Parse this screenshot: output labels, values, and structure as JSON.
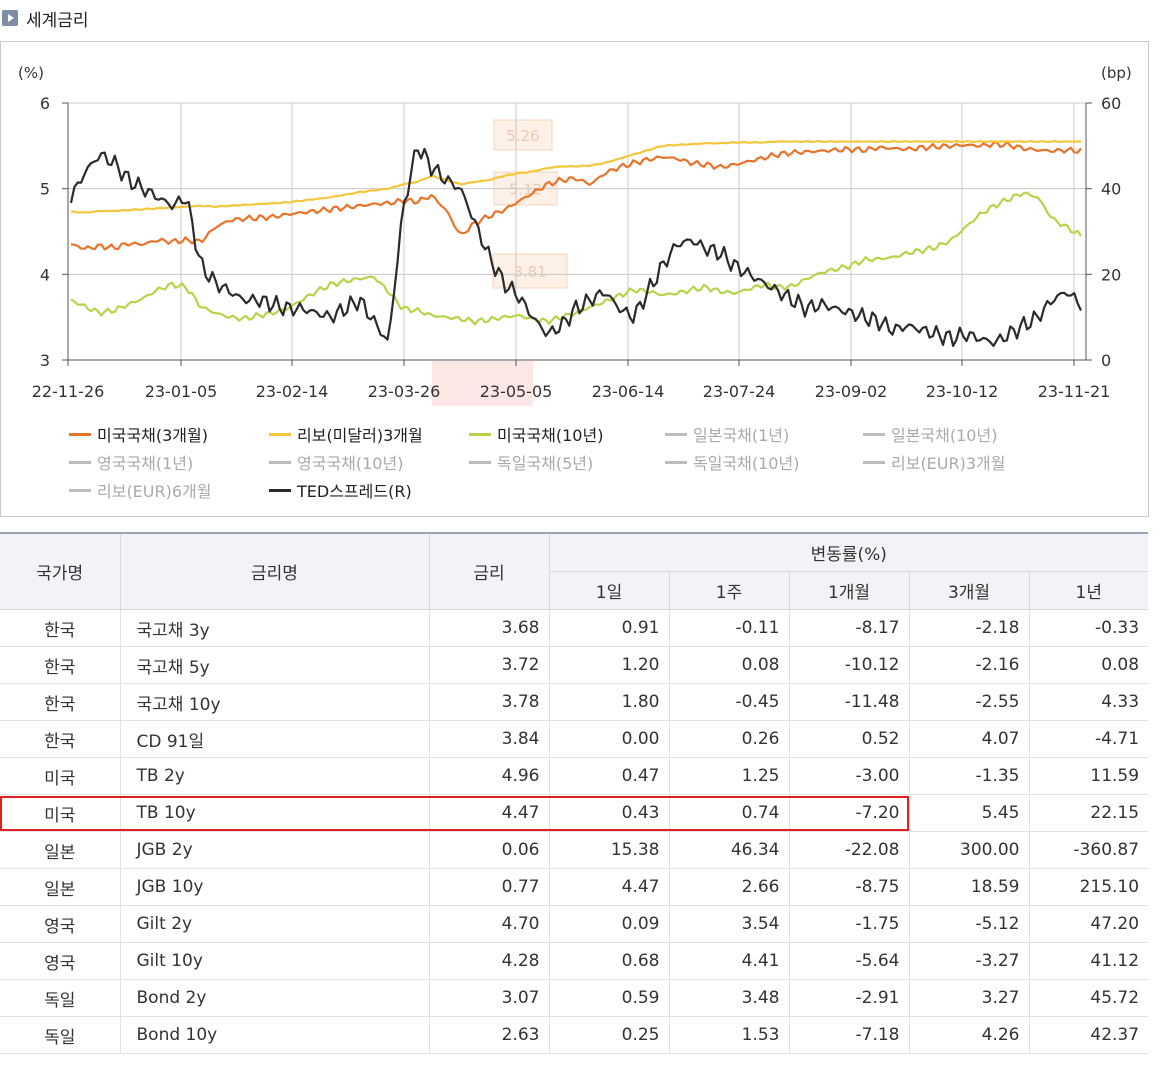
{
  "section": {
    "title": "세계금리",
    "icon": "play-icon"
  },
  "chart_data": {
    "type": "line",
    "left_axis": {
      "unit_label": "(%)",
      "ticks": [
        "6",
        "5",
        "4",
        "3"
      ],
      "range": [
        3,
        6
      ]
    },
    "right_axis": {
      "unit_label": "(bp)",
      "ticks": [
        "60",
        "40",
        "20",
        "0"
      ],
      "range": [
        0,
        60
      ]
    },
    "x_ticks": [
      "22-11-26",
      "23-01-05",
      "23-02-14",
      "23-03-26",
      "23-05-05",
      "23-06-14",
      "23-07-24",
      "23-09-02",
      "23-10-12",
      "23-11-21"
    ],
    "grid": true,
    "tooltip_labels": [
      "5.26",
      "5.12",
      "3.81"
    ],
    "series": [
      {
        "name": "미국국채(3개월)",
        "color": "#e8732a",
        "axis": "left",
        "active": true,
        "values": [
          4.35,
          4.3,
          4.33,
          4.31,
          4.36,
          4.35,
          4.4,
          4.38,
          4.4,
          4.38,
          4.55,
          4.63,
          4.65,
          4.66,
          4.67,
          4.7,
          4.72,
          4.74,
          4.76,
          4.78,
          4.8,
          4.82,
          4.83,
          4.86,
          4.85,
          4.92,
          4.75,
          4.45,
          4.6,
          4.68,
          4.75,
          4.85,
          4.95,
          5.05,
          5.1,
          5.12,
          5.05,
          5.18,
          5.25,
          5.3,
          5.34,
          5.37,
          5.35,
          5.3,
          5.28,
          5.25,
          5.28,
          5.32,
          5.36,
          5.4,
          5.42,
          5.43,
          5.44,
          5.45,
          5.46,
          5.45,
          5.48,
          5.47,
          5.46,
          5.48,
          5.49,
          5.5,
          5.51,
          5.5,
          5.52,
          5.51,
          5.47,
          5.45,
          5.44,
          5.45,
          5.44
        ]
      },
      {
        "name": "리보(미달러)3개월",
        "color": "#f5c63b",
        "axis": "left",
        "active": true,
        "values": [
          4.73,
          4.72,
          4.74,
          4.74,
          4.75,
          4.76,
          4.77,
          4.78,
          4.79,
          4.8,
          4.79,
          4.8,
          4.81,
          4.82,
          4.83,
          4.84,
          4.86,
          4.88,
          4.9,
          4.93,
          4.96,
          4.98,
          5.0,
          5.05,
          5.08,
          5.15,
          5.1,
          5.05,
          5.08,
          5.1,
          5.15,
          5.18,
          5.2,
          5.24,
          5.26,
          5.26,
          5.27,
          5.3,
          5.35,
          5.4,
          5.45,
          5.5,
          5.51,
          5.52,
          5.53,
          5.53,
          5.54,
          5.54,
          5.54,
          5.55,
          5.55,
          5.55,
          5.55,
          5.55,
          5.55,
          5.55,
          5.55,
          5.55,
          5.55,
          5.55,
          5.55,
          5.55,
          5.55,
          5.55,
          5.55,
          5.55,
          5.55,
          5.55,
          5.55,
          5.55,
          5.55
        ]
      },
      {
        "name": "미국국채(10년)",
        "color": "#b5d44a",
        "axis": "left",
        "active": true,
        "values": [
          3.7,
          3.62,
          3.55,
          3.58,
          3.65,
          3.72,
          3.82,
          3.88,
          3.85,
          3.62,
          3.55,
          3.5,
          3.48,
          3.52,
          3.55,
          3.6,
          3.7,
          3.8,
          3.88,
          3.92,
          3.95,
          3.97,
          3.8,
          3.6,
          3.58,
          3.52,
          3.5,
          3.48,
          3.45,
          3.47,
          3.5,
          3.52,
          3.48,
          3.45,
          3.5,
          3.55,
          3.62,
          3.68,
          3.75,
          3.82,
          3.8,
          3.76,
          3.78,
          3.82,
          3.85,
          3.8,
          3.78,
          3.83,
          3.88,
          3.85,
          3.86,
          3.95,
          4.02,
          4.06,
          4.1,
          4.17,
          4.18,
          4.2,
          4.25,
          4.28,
          4.32,
          4.4,
          4.55,
          4.7,
          4.8,
          4.88,
          4.95,
          4.9,
          4.65,
          4.55,
          4.45
        ]
      },
      {
        "name": "일본국채(1년)",
        "color": "#b0b0b0",
        "axis": "left",
        "active": false
      },
      {
        "name": "일본국채(10년)",
        "color": "#b0b0b0",
        "axis": "left",
        "active": false
      },
      {
        "name": "영국국채(1년)",
        "color": "#b0b0b0",
        "axis": "left",
        "active": false
      },
      {
        "name": "영국국채(10년)",
        "color": "#b0b0b0",
        "axis": "left",
        "active": false
      },
      {
        "name": "독일국채(5년)",
        "color": "#b0b0b0",
        "axis": "left",
        "active": false
      },
      {
        "name": "독일국채(10년)",
        "color": "#b0b0b0",
        "axis": "left",
        "active": false
      },
      {
        "name": "리보(EUR)3개월",
        "color": "#b0b0b0",
        "axis": "left",
        "active": false
      },
      {
        "name": "리보(EUR)6개월",
        "color": "#b0b0b0",
        "axis": "left",
        "active": false
      },
      {
        "name": "TED스프레드(R)",
        "color": "#2b2b2b",
        "axis": "right",
        "active": true,
        "values": [
          38,
          44,
          48,
          46,
          42,
          40,
          38,
          36,
          38,
          22,
          18,
          16,
          14,
          14,
          13,
          12,
          12,
          11,
          10,
          12,
          14,
          9,
          4,
          35,
          50,
          45,
          42,
          40,
          32,
          24,
          18,
          15,
          10,
          6,
          8,
          12,
          14,
          16,
          12,
          10,
          16,
          22,
          27,
          28,
          26,
          25,
          22,
          20,
          18,
          16,
          14,
          12,
          13,
          12,
          11,
          10,
          9,
          7,
          8,
          7,
          6,
          5,
          6,
          5,
          4,
          6,
          8,
          10,
          14,
          16,
          13
        ]
      }
    ]
  },
  "table": {
    "headers": {
      "country": "국가명",
      "rate_name": "금리명",
      "rate": "금리",
      "change_group": "변동률(%)",
      "d1": "1일",
      "w1": "1주",
      "m1": "1개월",
      "m3": "3개월",
      "y1": "1년"
    },
    "rows": [
      {
        "country": "한국",
        "name": "국고채 3y",
        "rate": "3.68",
        "d1": "0.91",
        "w1": "-0.11",
        "m1": "-8.17",
        "m3": "-2.18",
        "y1": "-0.33"
      },
      {
        "country": "한국",
        "name": "국고채 5y",
        "rate": "3.72",
        "d1": "1.20",
        "w1": "0.08",
        "m1": "-10.12",
        "m3": "-2.16",
        "y1": "0.08"
      },
      {
        "country": "한국",
        "name": "국고채 10y",
        "rate": "3.78",
        "d1": "1.80",
        "w1": "-0.45",
        "m1": "-11.48",
        "m3": "-2.55",
        "y1": "4.33"
      },
      {
        "country": "한국",
        "name": "CD 91일",
        "rate": "3.84",
        "d1": "0.00",
        "w1": "0.26",
        "m1": "0.52",
        "m3": "4.07",
        "y1": "-4.71"
      },
      {
        "country": "미국",
        "name": "TB 2y",
        "rate": "4.96",
        "d1": "0.47",
        "w1": "1.25",
        "m1": "-3.00",
        "m3": "-1.35",
        "y1": "11.59"
      },
      {
        "country": "미국",
        "name": "TB 10y",
        "rate": "4.47",
        "d1": "0.43",
        "w1": "0.74",
        "m1": "-7.20",
        "m3": "5.45",
        "y1": "22.15"
      },
      {
        "country": "일본",
        "name": "JGB 2y",
        "rate": "0.06",
        "d1": "15.38",
        "w1": "46.34",
        "m1": "-22.08",
        "m3": "300.00",
        "y1": "-360.87"
      },
      {
        "country": "일본",
        "name": "JGB 10y",
        "rate": "0.77",
        "d1": "4.47",
        "w1": "2.66",
        "m1": "-8.75",
        "m3": "18.59",
        "y1": "215.10"
      },
      {
        "country": "영국",
        "name": "Gilt 2y",
        "rate": "4.70",
        "d1": "0.09",
        "w1": "3.54",
        "m1": "-1.75",
        "m3": "-5.12",
        "y1": "47.20"
      },
      {
        "country": "영국",
        "name": "Gilt 10y",
        "rate": "4.28",
        "d1": "0.68",
        "w1": "4.41",
        "m1": "-5.64",
        "m3": "-3.27",
        "y1": "41.12"
      },
      {
        "country": "독일",
        "name": "Bond 2y",
        "rate": "3.07",
        "d1": "0.59",
        "w1": "3.48",
        "m1": "-2.91",
        "m3": "3.27",
        "y1": "45.72"
      },
      {
        "country": "독일",
        "name": "Bond 10y",
        "rate": "2.63",
        "d1": "0.25",
        "w1": "1.53",
        "m1": "-7.18",
        "m3": "4.26",
        "y1": "42.37"
      }
    ]
  },
  "highlight_color": "#e32020"
}
